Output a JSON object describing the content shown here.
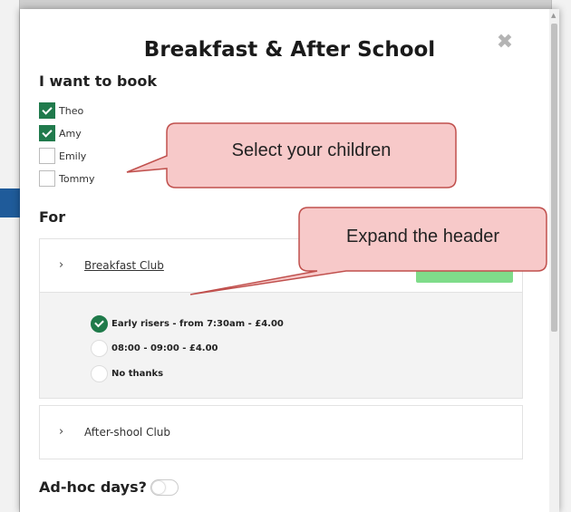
{
  "modal": {
    "title": "Breakfast & After School",
    "close_icon": "close-icon"
  },
  "booking": {
    "heading": "I want to book",
    "children": [
      {
        "name": "Theo",
        "checked": true
      },
      {
        "name": "Amy",
        "checked": true
      },
      {
        "name": "Emily",
        "checked": false
      },
      {
        "name": "Tommy",
        "checked": false
      }
    ]
  },
  "for_section": {
    "heading": "For",
    "clubs": [
      {
        "title": "Breakfast Club",
        "expanded": true,
        "options": [
          {
            "label": "Early risers - from 7:30am - £4.00",
            "selected": true
          },
          {
            "label": "08:00 - 09:00 - £4.00",
            "selected": false
          },
          {
            "label": "No thanks",
            "selected": false
          }
        ]
      },
      {
        "title": "After-shool Club",
        "expanded": false
      }
    ]
  },
  "adhoc": {
    "label": "Ad-hoc days?",
    "toggle_on": false
  },
  "callouts": [
    {
      "text": "Select your children"
    },
    {
      "text": "Expand the header"
    }
  ],
  "colors": {
    "accent_green": "#207a4c",
    "pill_green": "#7fdc8a",
    "callout_fill": "#f7c9c9",
    "callout_border": "#c0504d"
  }
}
